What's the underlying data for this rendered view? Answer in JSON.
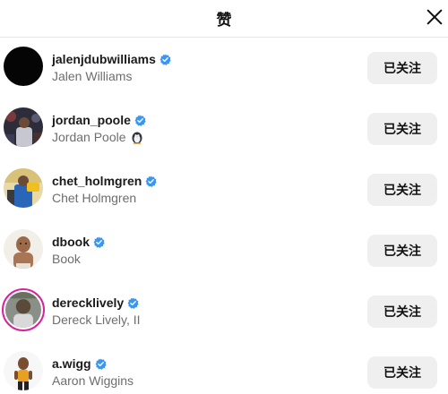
{
  "header": {
    "title": "赞",
    "close_icon": "close-icon"
  },
  "users": [
    {
      "username": "jalenjdubwilliams",
      "full_name": "Jalen Williams",
      "verified": true,
      "follow_label": "已关注",
      "has_story_ring": false
    },
    {
      "username": "jordan_poole",
      "full_name": "Jordan Poole",
      "verified": true,
      "follow_label": "已关注",
      "has_story_ring": false,
      "name_emoji": "penguin-emoji"
    },
    {
      "username": "chet_holmgren",
      "full_name": "Chet Holmgren",
      "verified": true,
      "follow_label": "已关注",
      "has_story_ring": false
    },
    {
      "username": "dbook",
      "full_name": "Book",
      "verified": true,
      "follow_label": "已关注",
      "has_story_ring": false
    },
    {
      "username": "dereckl​ively",
      "full_name": "Dereck Lively, II",
      "verified": true,
      "follow_label": "已关注",
      "has_story_ring": true
    },
    {
      "username": "a.wigg",
      "full_name": "Aaron Wiggins",
      "verified": true,
      "follow_label": "已关注",
      "has_story_ring": false
    }
  ],
  "colors": {
    "verified_badge": "#3897f0",
    "story_ring": "#d6249f",
    "button_bg": "#efefef",
    "secondary_text": "#6e6e6e"
  }
}
